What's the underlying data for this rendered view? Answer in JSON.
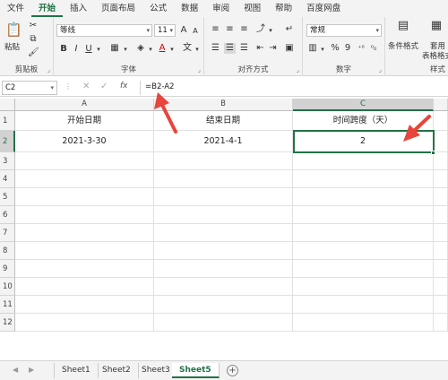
{
  "menu": [
    "文件",
    "开始",
    "插入",
    "页面布局",
    "公式",
    "数据",
    "审阅",
    "视图",
    "帮助",
    "百度网盘"
  ],
  "active_menu_index": 1,
  "ribbon": {
    "clipboard": {
      "paste_label": "粘贴",
      "group_label": "剪贴板"
    },
    "font": {
      "font_name": "等线",
      "font_size": "11",
      "grow": "A",
      "shrink": "A",
      "bold": "B",
      "italic": "I",
      "underline": "U",
      "wen": "文",
      "group_label": "字体"
    },
    "alignment": {
      "group_label": "对齐方式"
    },
    "number": {
      "format": "常规",
      "percent": "%",
      "comma": "9",
      "group_label": "数字"
    },
    "styles": {
      "conditional_label": "条件格式",
      "table_label_1": "套用",
      "table_label_2": "表格格式",
      "group_label": "样式"
    }
  },
  "formula_bar": {
    "name_box": "C2",
    "fx": "fx",
    "formula": "=B2-A2"
  },
  "columns": [
    "A",
    "B",
    "C"
  ],
  "rows": [
    "1",
    "2",
    "3",
    "4",
    "5",
    "6",
    "7",
    "8",
    "9",
    "10",
    "11",
    "12"
  ],
  "cells": {
    "A1": "开始日期",
    "B1": "结束日期",
    "C1": "时间跨度（天）",
    "A2": "2021-3-30",
    "B2": "2021-4-1",
    "C2": "2"
  },
  "sheet_tabs": [
    "Sheet1",
    "Sheet2",
    "Sheet3",
    "Sheet5"
  ],
  "active_sheet": "Sheet5",
  "add_sheet": "+",
  "annotation_color": "#e8453c",
  "accent_color": "#217346"
}
